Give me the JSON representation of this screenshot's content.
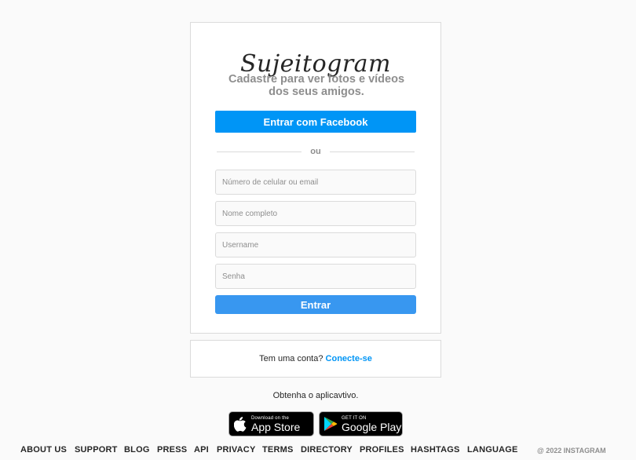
{
  "brand": {
    "logo_text": "Sujeitogram",
    "tagline": "Cadastre para ver fotos e vídeos dos seus amigos."
  },
  "signup": {
    "facebook_label": "Entrar com Facebook",
    "divider_text": "ou",
    "fields": [
      {
        "placeholder": "Número de celular ou email",
        "value": ""
      },
      {
        "placeholder": "Nome completo",
        "value": ""
      },
      {
        "placeholder": "Username",
        "value": ""
      },
      {
        "placeholder": "Senha",
        "value": ""
      }
    ],
    "submit_label": "Entrar"
  },
  "login_prompt": {
    "text": "Tem uma conta?",
    "link_label": "Conecte-se"
  },
  "get_app": {
    "text": "Obtenha o aplicavtivo.",
    "app_store": {
      "small": "Download on the",
      "big": "App Store"
    },
    "google_play": {
      "small": "GET IT ON",
      "big": "Google Play"
    }
  },
  "footer": {
    "links": [
      "ABOUT US",
      "SUPPORT",
      "BLOG",
      "PRESS",
      "API",
      "PRIVACY",
      "TERMS",
      "DIRECTORY",
      "PROFILES",
      "HASHTAGS",
      "LANGUAGE"
    ],
    "copyright": "@ 2022 INSTAGRAM"
  },
  "colors": {
    "accent": "#0095f6",
    "submit": "#3897f0",
    "background": "#fafafa",
    "border": "#dbdbdb",
    "muted_text": "#8e8e8e"
  },
  "icons": [
    "apple-icon",
    "google-play-icon"
  ]
}
